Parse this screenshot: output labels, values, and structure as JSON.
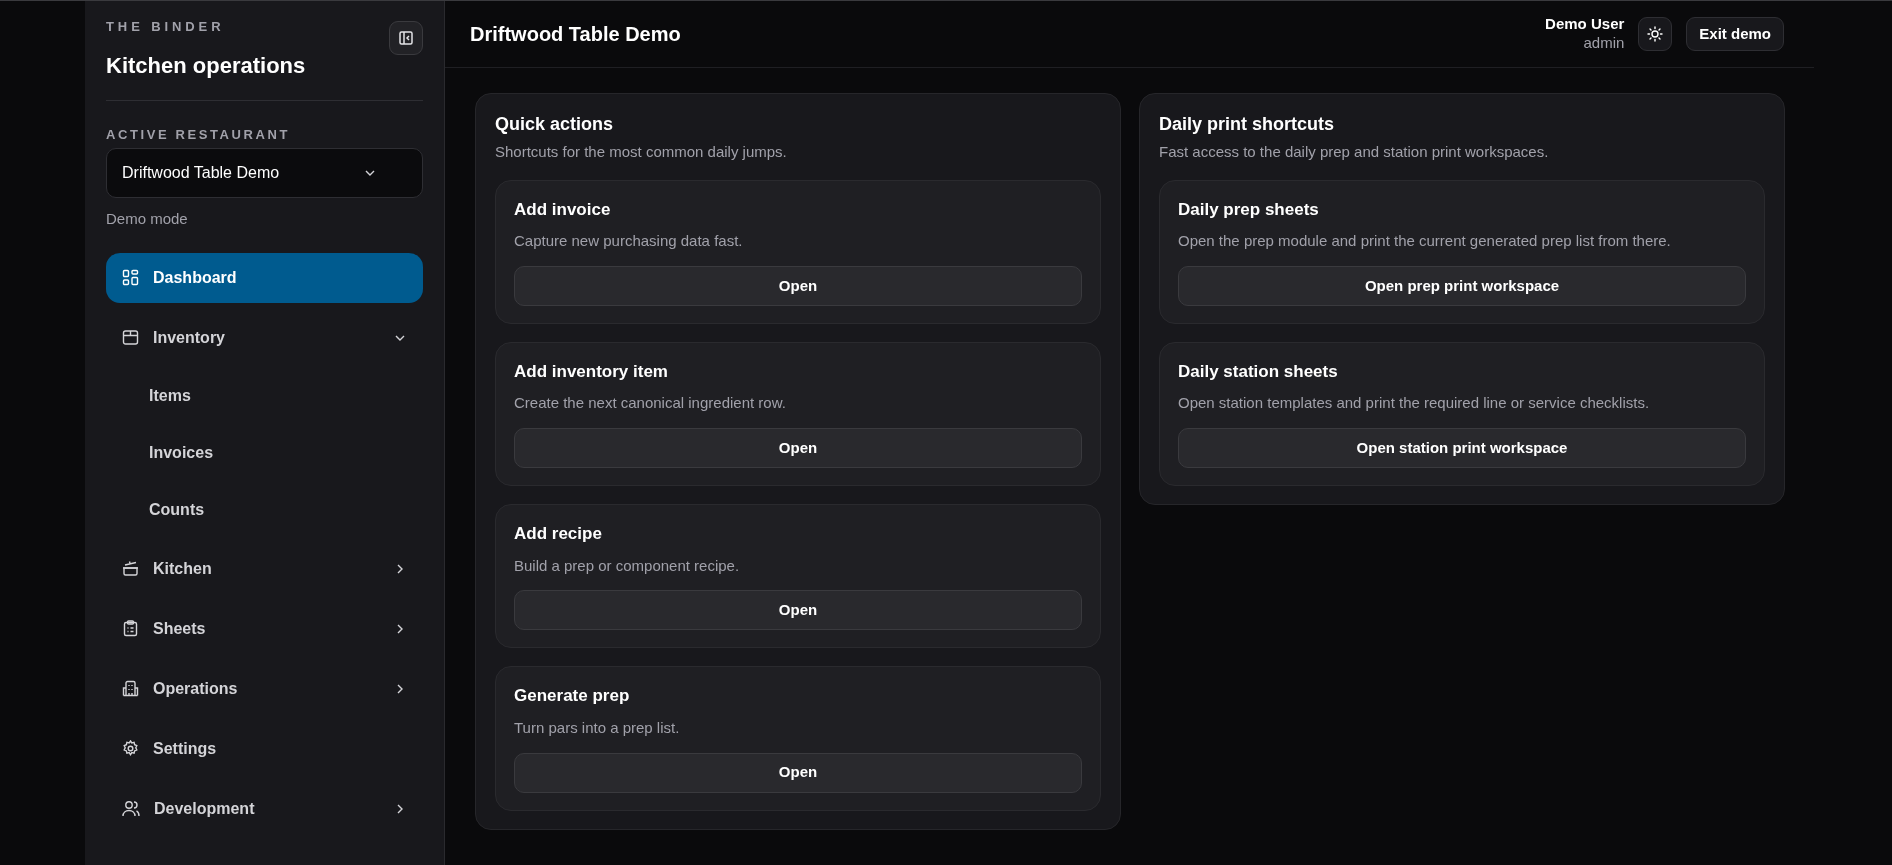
{
  "sidebar": {
    "brand": "THE BINDER",
    "title": "Kitchen operations",
    "restaurant_label": "ACTIVE RESTAURANT",
    "restaurant_select": {
      "value": "Driftwood Table Demo"
    },
    "mode": "Demo mode",
    "nav": [
      {
        "label": "Dashboard",
        "kind": "link",
        "selected": true
      },
      {
        "label": "Inventory",
        "kind": "group",
        "selected": false,
        "expanded": true,
        "children": [
          {
            "label": "Items",
            "selected": false
          },
          {
            "label": "Invoices",
            "selected": false
          },
          {
            "label": "Counts",
            "selected": false
          }
        ]
      },
      {
        "label": "Kitchen",
        "kind": "group",
        "selected": false,
        "expanded": false
      },
      {
        "label": "Sheets",
        "kind": "group",
        "selected": false,
        "expanded": false
      },
      {
        "label": "Operations",
        "kind": "group",
        "selected": false,
        "expanded": false
      },
      {
        "label": "Settings",
        "kind": "link",
        "selected": false
      },
      {
        "label": "Development",
        "kind": "group",
        "selected": false,
        "expanded": false
      }
    ]
  },
  "header": {
    "title": "Driftwood Table Demo",
    "user": {
      "name": "Demo User",
      "role": "admin"
    },
    "exit_button": "Exit demo"
  },
  "panels": [
    {
      "title": "Quick actions",
      "subtitle": "Shortcuts for the most common daily jumps.",
      "cards": [
        {
          "title": "Add invoice",
          "description": "Capture new purchasing data fast.",
          "button": "Open"
        },
        {
          "title": "Add inventory item",
          "description": "Create the next canonical ingredient row.",
          "button": "Open"
        },
        {
          "title": "Add recipe",
          "description": "Build a prep or component recipe.",
          "button": "Open"
        },
        {
          "title": "Generate prep",
          "description": "Turn pars into a prep list.",
          "button": "Open"
        }
      ]
    },
    {
      "title": "Daily print shortcuts",
      "subtitle": "Fast access to the daily prep and station print workspaces.",
      "cards": [
        {
          "title": "Daily prep sheets",
          "description": "Open the prep module and print the current generated prep list from there.",
          "button": "Open prep print workspace"
        },
        {
          "title": "Daily station sheets",
          "description": "Open station templates and print the required line or service checklists.",
          "button": "Open station print workspace"
        }
      ]
    }
  ]
}
